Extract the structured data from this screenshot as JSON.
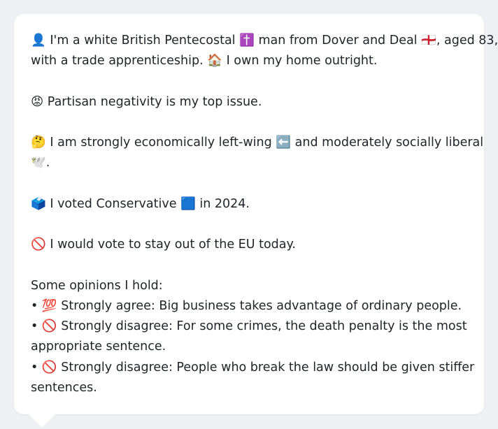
{
  "message": {
    "line1": "👤 I'm a white British Pentecostal ✝️ man from Dover and Deal 🏴󠁧󠁢󠁥󠁮󠁧󠁿, aged 83,",
    "line2": "with a trade apprenticeship. 🏠 I own my home outright.",
    "line3": "😡 Partisan negativity is my top issue.",
    "line4": "🤔 I am strongly economically left-wing ⬅️ and moderately socially liberal",
    "line5": "🕊️.",
    "line6": "🗳️ I voted Conservative 🟦 in 2024.",
    "line7": "🚫 I would vote to stay out of the EU today.",
    "line8": "Some opinions I hold:",
    "line9": "• 💯 Strongly agree: Big business takes advantage of ordinary people.",
    "line10": "• 🚫 Strongly disagree: For some crimes, the death penalty is the most",
    "line11": "appropriate sentence.",
    "line12": "• 🚫 Strongly disagree: People who break the law should be given stiffer",
    "line13": "sentences."
  }
}
